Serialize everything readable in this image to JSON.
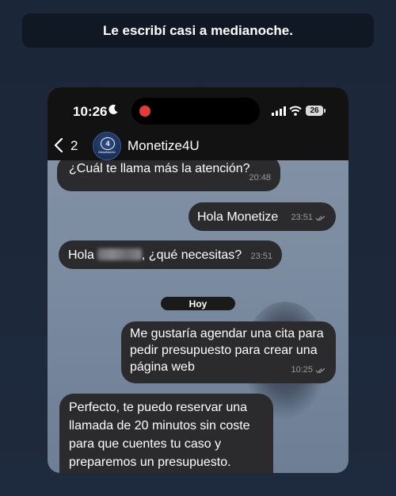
{
  "caption": "Le escribí casi a medianoche.",
  "status_bar": {
    "time": "10:26",
    "battery": "26"
  },
  "header": {
    "back_count": "2",
    "contact_name": "Monetize4U",
    "avatar_text": "Monetize4U"
  },
  "messages": [
    {
      "direction": "incoming",
      "text": "¿Cuál te llama más la atención?",
      "time": "20:48"
    },
    {
      "direction": "outgoing",
      "text": "Hola Monetize",
      "time": "23:51"
    },
    {
      "direction": "incoming",
      "text_before": "Hola",
      "text_after": ", ¿qué necesitas?",
      "time": "23:51"
    },
    {
      "direction": "outgoing",
      "text": "Me gustaría agendar una cita para pedir presupuesto para crear una página web",
      "time": "10:25"
    },
    {
      "direction": "incoming",
      "text": "Perfecto, te puedo reservar una llamada de 20 minutos sin coste para que cuentes tu caso y preparemos un presupuesto."
    }
  ],
  "day_separator": "Hoy",
  "colors": {
    "bubble": "#2b2b2d",
    "chat_background": "#8190a4",
    "recording_dot": "#e53a3a"
  }
}
